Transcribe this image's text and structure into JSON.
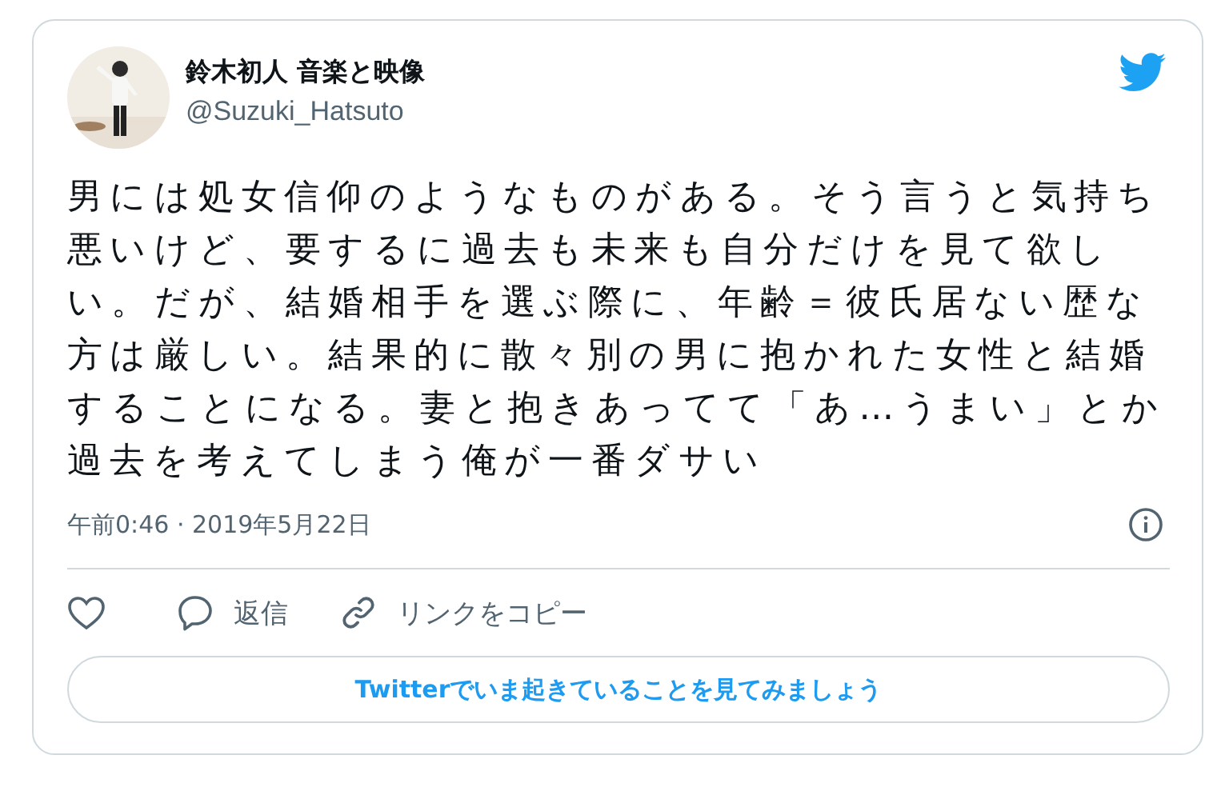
{
  "author": {
    "name": "鈴木初人 音楽と映像",
    "handle": "@Suzuki_Hatsuto"
  },
  "text": "男には処女信仰のようなものがある。そう言うと気持ち悪いけど、要するに過去も未来も自分だけを見て欲しい。だが、結婚相手を選ぶ際に、年齢＝彼氏居ない歴な方は厳しい。結果的に散々別の男に抱かれた女性と結婚することになる。妻と抱きあってて「あ…うまい」とか過去を考えてしまう俺が一番ダサい",
  "timestamp": "午前0:46 · 2019年5月22日",
  "actions": [
    {
      "kind": "like"
    },
    {
      "kind": "reply",
      "label": "返信"
    },
    {
      "kind": "link",
      "label": "リンクをコピー"
    }
  ],
  "cta": "Twitterでいま起きていることを見てみましょう"
}
